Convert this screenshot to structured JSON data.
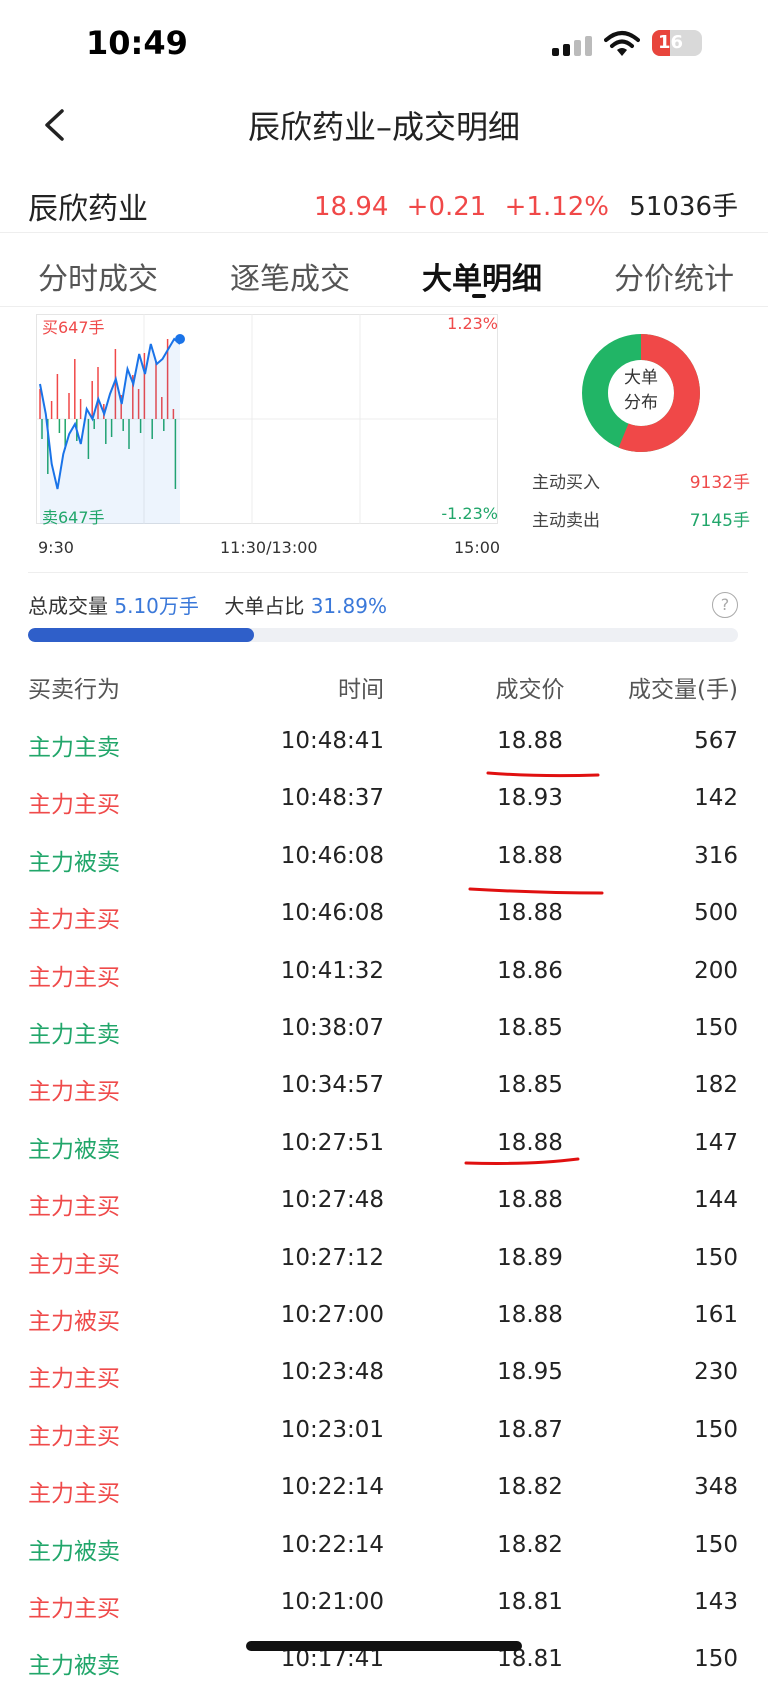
{
  "status": {
    "time": "10:49",
    "battery": "16"
  },
  "nav": {
    "title": "辰欣药业–成交明细"
  },
  "stock": {
    "name": "辰欣药业",
    "price": "18.94",
    "change": "+0.21",
    "change_pct": "+1.12%",
    "volume": "51036手"
  },
  "tabs": [
    {
      "label": "分时成交",
      "active": false
    },
    {
      "label": "逐笔成交",
      "active": false
    },
    {
      "label": "大单明细",
      "active": true
    },
    {
      "label": "分价统计",
      "active": false
    }
  ],
  "chart": {
    "buy_label": "买647手",
    "sell_label": "卖647手",
    "top_pct": "1.23%",
    "bottom_pct": "-1.23%",
    "x_labels": [
      "9:30",
      "11:30/13:00",
      "15:00"
    ],
    "colors": {
      "line": "#1a73e8",
      "buy": "#f04848",
      "sell": "#21a66a"
    }
  },
  "donut": {
    "label_line1": "大单",
    "label_line2": "分布",
    "buy_label": "主动买入",
    "buy_value": "9132手",
    "sell_label": "主动卖出",
    "sell_value": "7145手",
    "buy_share": 0.561,
    "colors": {
      "buy": "#f04848",
      "sell": "#21b566"
    }
  },
  "summary": {
    "total_label": "总成交量",
    "total_value": "5.10万手",
    "ratio_label": "大单占比",
    "ratio_value": "31.89%",
    "ratio_fraction": 0.3189,
    "help": "?"
  },
  "table": {
    "headers": [
      "买卖行为",
      "时间",
      "成交价",
      "成交量(手)"
    ],
    "rows": [
      {
        "action": "主力主卖",
        "side": "sell",
        "time": "10:48:41",
        "price": "18.88",
        "volume": "567"
      },
      {
        "action": "主力主买",
        "side": "buy",
        "time": "10:48:37",
        "price": "18.93",
        "volume": "142"
      },
      {
        "action": "主力被卖",
        "side": "sell",
        "time": "10:46:08",
        "price": "18.88",
        "volume": "316"
      },
      {
        "action": "主力主买",
        "side": "buy",
        "time": "10:46:08",
        "price": "18.88",
        "volume": "500"
      },
      {
        "action": "主力主买",
        "side": "buy",
        "time": "10:41:32",
        "price": "18.86",
        "volume": "200"
      },
      {
        "action": "主力主卖",
        "side": "sell",
        "time": "10:38:07",
        "price": "18.85",
        "volume": "150"
      },
      {
        "action": "主力主买",
        "side": "buy",
        "time": "10:34:57",
        "price": "18.85",
        "volume": "182"
      },
      {
        "action": "主力被卖",
        "side": "sell",
        "time": "10:27:51",
        "price": "18.88",
        "volume": "147"
      },
      {
        "action": "主力主买",
        "side": "buy",
        "time": "10:27:48",
        "price": "18.88",
        "volume": "144"
      },
      {
        "action": "主力主买",
        "side": "buy",
        "time": "10:27:12",
        "price": "18.89",
        "volume": "150"
      },
      {
        "action": "主力被买",
        "side": "buy",
        "time": "10:27:00",
        "price": "18.88",
        "volume": "161"
      },
      {
        "action": "主力主买",
        "side": "buy",
        "time": "10:23:48",
        "price": "18.95",
        "volume": "230"
      },
      {
        "action": "主力主买",
        "side": "buy",
        "time": "10:23:01",
        "price": "18.87",
        "volume": "150"
      },
      {
        "action": "主力主买",
        "side": "buy",
        "time": "10:22:14",
        "price": "18.82",
        "volume": "348"
      },
      {
        "action": "主力被卖",
        "side": "sell",
        "time": "10:22:14",
        "price": "18.82",
        "volume": "150"
      },
      {
        "action": "主力主买",
        "side": "buy",
        "time": "10:21:00",
        "price": "18.81",
        "volume": "143"
      },
      {
        "action": "主力被卖",
        "side": "sell",
        "time": "10:17:41",
        "price": "18.81",
        "volume": "150"
      }
    ]
  }
}
